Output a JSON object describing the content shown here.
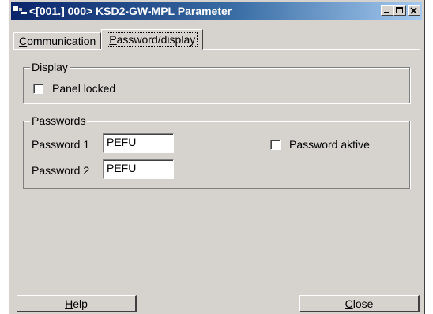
{
  "window": {
    "title": "<[001.] 000> KSD2-GW-MPL Parameter",
    "controls": [
      "minimize-icon",
      "maximize-icon",
      "close-icon"
    ]
  },
  "tabs": [
    {
      "label_accel": "C",
      "label_rest": "ommunication",
      "active": false
    },
    {
      "label_accel": "P",
      "label_rest": "assword/display",
      "active": true
    }
  ],
  "display_group": {
    "title": "Display",
    "panel_locked": {
      "label": "Panel locked",
      "checked": false
    }
  },
  "passwords_group": {
    "title": "Passwords",
    "password1": {
      "label": "Password 1",
      "value": "PEFU"
    },
    "password2": {
      "label": "Password 2",
      "value": "PEFU"
    },
    "password_aktive": {
      "label": "Password aktive",
      "checked": false
    }
  },
  "buttons": {
    "help": {
      "accel": "H",
      "rest": "elp"
    },
    "close": {
      "accel": "C",
      "rest": "lose"
    }
  }
}
